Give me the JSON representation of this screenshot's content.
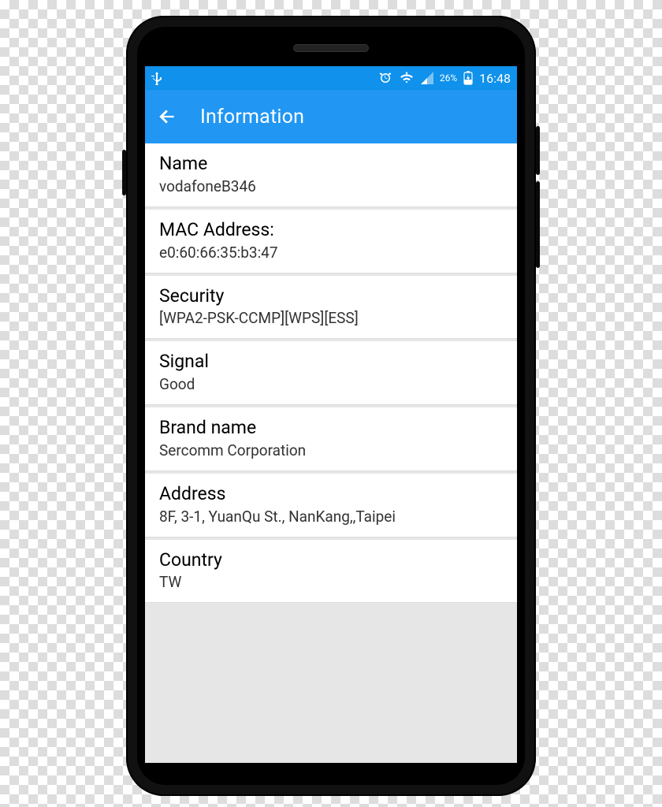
{
  "status": {
    "battery_pct": "26%",
    "time": "16:48"
  },
  "app_bar": {
    "title": "Information"
  },
  "rows": [
    {
      "label": "Name",
      "value": "vodafoneB346"
    },
    {
      "label": "MAC Address:",
      "value": "e0:60:66:35:b3:47"
    },
    {
      "label": "Security",
      "value": "[WPA2-PSK-CCMP][WPS][ESS]"
    },
    {
      "label": "Signal",
      "value": "Good"
    },
    {
      "label": "Brand name",
      "value": "Sercomm Corporation"
    },
    {
      "label": "Address",
      "value": "8F, 3-1, YuanQu St., NanKang,,Taipei"
    },
    {
      "label": "Country",
      "value": "TW"
    }
  ]
}
